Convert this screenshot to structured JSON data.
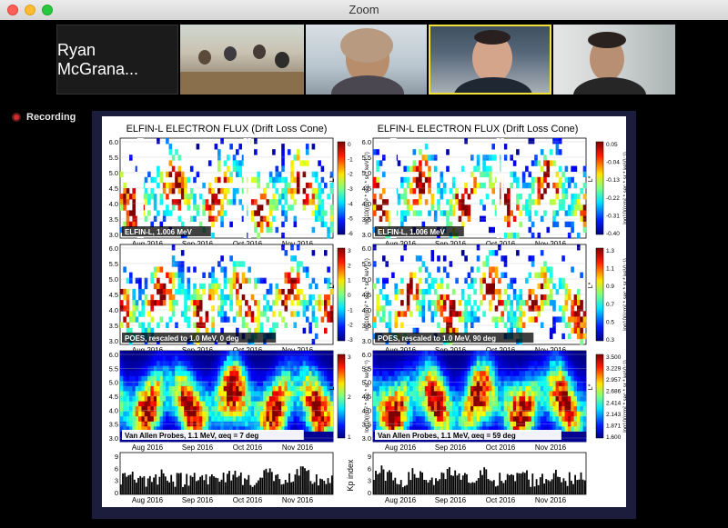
{
  "window": {
    "title": "Zoom"
  },
  "gallery": {
    "name_tile": "Ryan McGrana..."
  },
  "recording": {
    "label": "Recording"
  },
  "slide": {
    "left_title": "ELFIN-L ELECTRON FLUX (Drift Loss Cone)",
    "right_title": "ELFIN-L ELECTRON FLUX (Drift Loss Cone)",
    "months": [
      "Aug 2016",
      "Sep 2016",
      "Oct 2016",
      "Nov 2016"
    ],
    "l_ticks": [
      "6.0",
      "5.5",
      "5.0",
      "4.5",
      "4.0",
      "3.5",
      "3.0"
    ],
    "kp_ticks": [
      "9",
      "6",
      "3",
      "0"
    ],
    "kp_label": "Kp index",
    "lstar_label": "L*",
    "panels": [
      {
        "label": "ELFIN-L, 1.006 MeV",
        "cbar": [
          "0",
          "-1",
          "-2",
          "-3",
          "-4",
          "-5",
          "-6"
        ]
      },
      {
        "label": "ELFIN-L, 1.006 MeV",
        "cbar": [
          "0.05",
          "-0.04",
          "-0.13",
          "-0.22",
          "-0.31",
          "-0.40"
        ]
      },
      {
        "label": "POES, rescaled to 1.0 MeV, 0 deg",
        "cbar": [
          "3",
          "2",
          "1",
          "0",
          "-1",
          "-2",
          "-3"
        ]
      },
      {
        "label": "POES, rescaled to 1.0 MeV, 90 deg",
        "cbar": [
          "1.3",
          "1.1",
          "0.9",
          "0.7",
          "0.5",
          "0.3"
        ]
      },
      {
        "label": "Van Allen Probes, 1.1 MeV, αeq = 7 deg",
        "cbar": [
          "3",
          "2",
          "1"
        ]
      },
      {
        "label": "Van Allen Probes, 1.1 MeV, αeq = 59 deg",
        "cbar": [
          "3.500",
          "3.229",
          "2.957",
          "2.686",
          "2.414",
          "2.143",
          "1.871",
          "1.600"
        ]
      }
    ],
    "cbar_units": "log10((cm² * sec * sr * keV)⁻¹)"
  }
}
